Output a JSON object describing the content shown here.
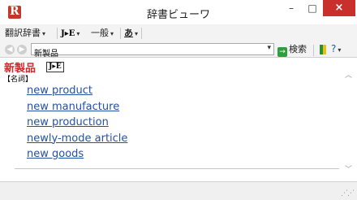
{
  "window": {
    "title": "辞書ビューワ",
    "app_icon_letter": "R",
    "minimize": "–",
    "maximize": "□",
    "close": "×"
  },
  "toolbar": {
    "dictionary_menu": "翻訳辞書",
    "direction_menu": "J▸E",
    "field_menu": "一般",
    "font_menu": "あ"
  },
  "search": {
    "back": "◀",
    "forward": "▶",
    "value": "新製品",
    "dropdown": "▾",
    "search_label": "検索",
    "go_arrow": "→",
    "help_caret": "▾"
  },
  "entry": {
    "headword": "新製品",
    "dict_badge": "J▸E",
    "part_of_speech": "【名詞】",
    "translations": [
      "new product",
      "new manufacture",
      "new production",
      "newly-mode article",
      "new goods"
    ]
  },
  "icons": {
    "app": "r-dictionary-icon",
    "back": "back-arrow-icon",
    "forward": "forward-arrow-icon",
    "go": "go-arrow-icon",
    "bookmark": "bookmark-icon",
    "help": "help-icon",
    "grip": "resize-grip-icon"
  },
  "colors": {
    "close_button": "#c9302c",
    "headword": "#d22a2a",
    "link": "#2450a8",
    "go_arrow": "#2e9e3e"
  }
}
